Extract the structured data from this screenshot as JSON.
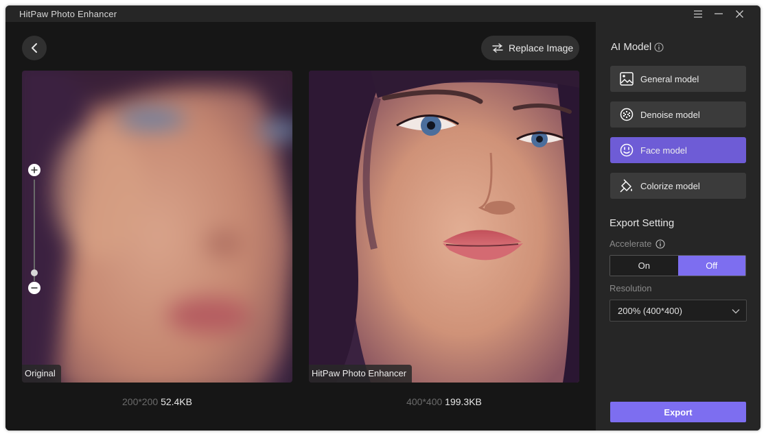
{
  "app": {
    "title": "HitPaw Photo Enhancer"
  },
  "toolbar": {
    "replace_label": "Replace Image"
  },
  "left_panel": {
    "label": "Original",
    "dimensions": "200*200",
    "size": "52.4KB"
  },
  "right_panel": {
    "label": "HitPaw Photo Enhancer",
    "dimensions": "400*400",
    "size": "199.3KB"
  },
  "sidebar": {
    "ai_model_title": "AI Model",
    "models": [
      {
        "label": "General model",
        "icon": "image-icon",
        "active": false
      },
      {
        "label": "Denoise model",
        "icon": "denoise-icon",
        "active": false
      },
      {
        "label": "Face model",
        "icon": "face-icon",
        "active": true
      },
      {
        "label": "Colorize model",
        "icon": "paint-bucket-icon",
        "active": false
      }
    ],
    "export_setting_title": "Export Setting",
    "accelerate_label": "Accelerate",
    "accelerate_on": "On",
    "accelerate_off": "Off",
    "accelerate_value": "Off",
    "resolution_label": "Resolution",
    "resolution_value": "200% (400*400)",
    "export_label": "Export"
  },
  "colors": {
    "accent": "#7d6ef0",
    "active_model": "#6e5cd6"
  }
}
